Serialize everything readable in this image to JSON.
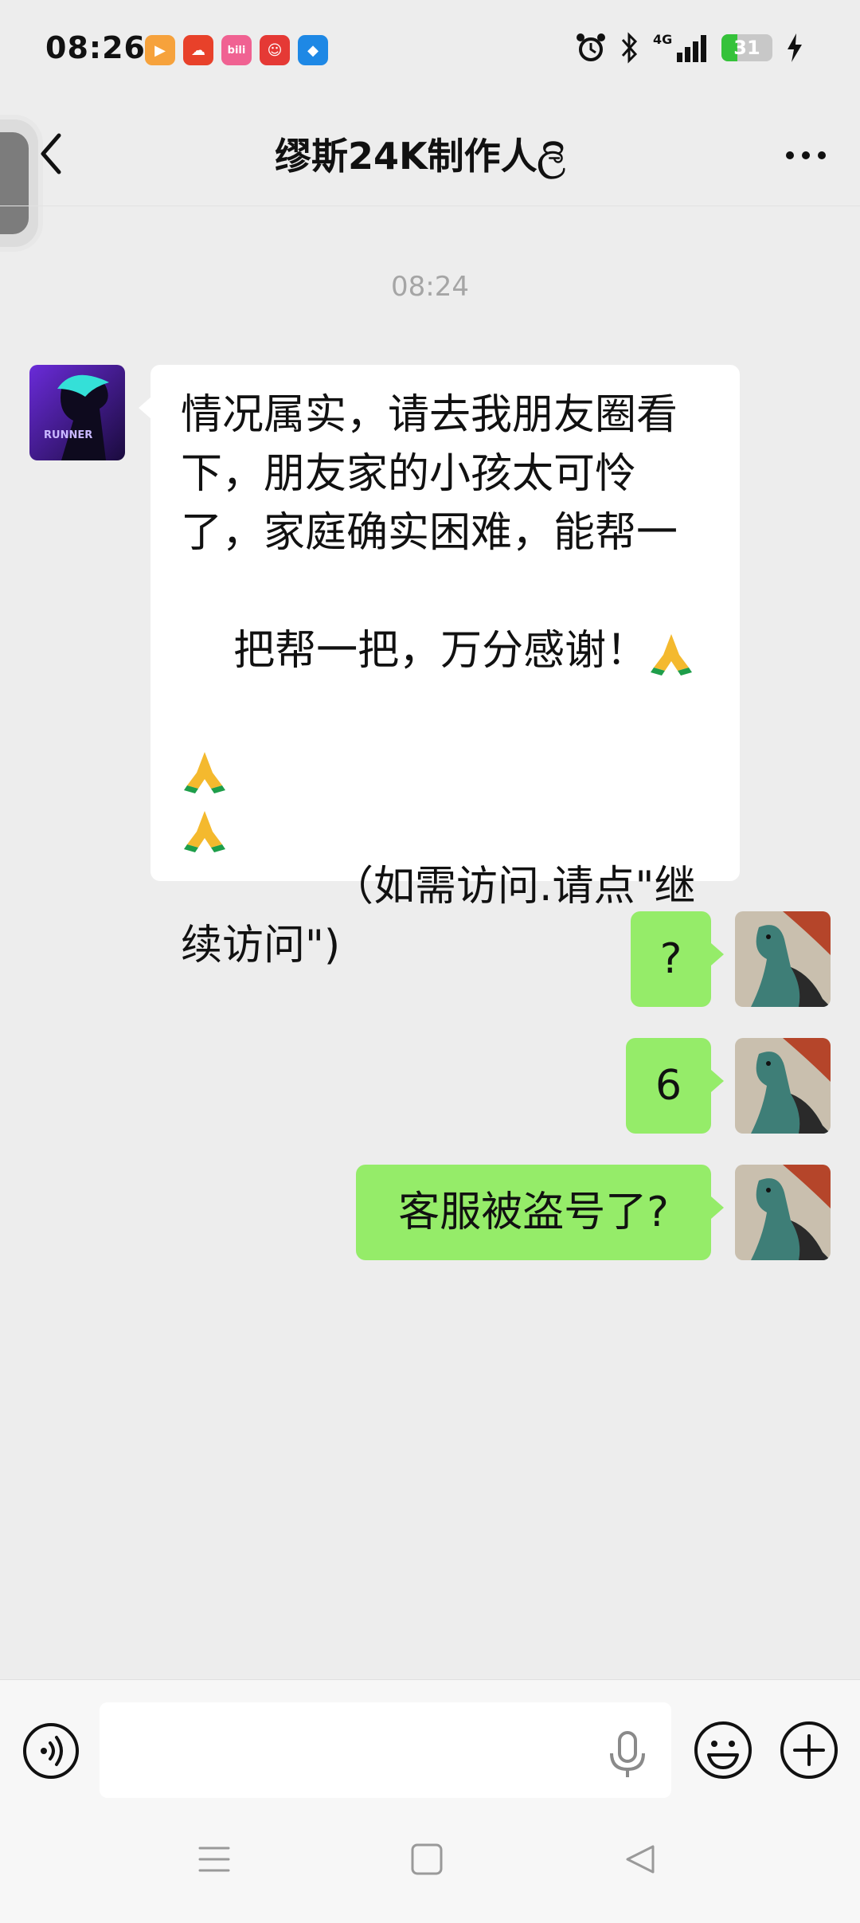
{
  "status_bar": {
    "time": "08:26",
    "network": "4G",
    "battery_level": "31",
    "battery_fraction": 0.31,
    "app_icons": [
      "video-app-icon",
      "cloud-app-icon",
      "bilibili-icon",
      "clown-app-icon",
      "blue-app-icon"
    ]
  },
  "header": {
    "title": "缪斯24K制作人ලි"
  },
  "chat": {
    "timestamp": "08:24",
    "incoming_message": {
      "lines": [
        "情况属实，请去我朋友圈看",
        "下，朋友家的小孩太可怜",
        "了，家庭确实困难，能帮一",
        "把帮一把，万分感谢！"
      ],
      "tail_text": "（如需访问.请点\"继",
      "last_line": "续访问\")",
      "emoji": "pray-emoji"
    },
    "outgoing_messages": [
      {
        "text": "?"
      },
      {
        "text": "6"
      },
      {
        "text": "客服被盗号了?"
      }
    ]
  },
  "input": {
    "placeholder": ""
  },
  "colors": {
    "background": "#EDEDED",
    "outgoing_bubble": "#95EC69",
    "incoming_bubble": "#FFFFFF",
    "timestamp": "#A5A5A5"
  }
}
